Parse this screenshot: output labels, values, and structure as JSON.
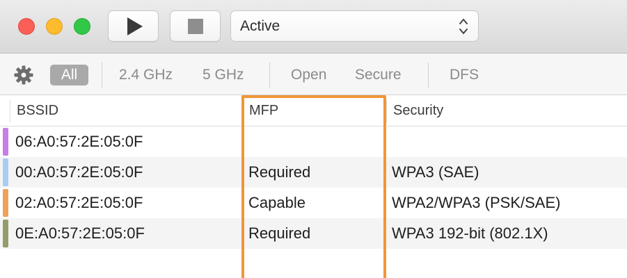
{
  "toolbar": {
    "mode_select": {
      "value": "Active"
    }
  },
  "filters": {
    "all": "All",
    "ghz24": "2.4 GHz",
    "ghz5": "5 GHz",
    "open": "Open",
    "secure": "Secure",
    "dfs": "DFS"
  },
  "table": {
    "columns": {
      "bssid": "BSSID",
      "mfp": "MFP",
      "security": "Security"
    },
    "rows": [
      {
        "bssid": "06:A0:57:2E:05:0F",
        "mfp": "",
        "security": "",
        "color": "#c77ee8"
      },
      {
        "bssid": "00:A0:57:2E:05:0F",
        "mfp": "Required",
        "security": "WPA3 (SAE)",
        "color": "#a9cdf5"
      },
      {
        "bssid": "02:A0:57:2E:05:0F",
        "mfp": "Capable",
        "security": "WPA2/WPA3 (PSK/SAE)",
        "color": "#eda25a"
      },
      {
        "bssid": "0E:A0:57:2E:05:0F",
        "mfp": "Required",
        "security": "WPA3 192-bit (802.1X)",
        "color": "#949d6a"
      }
    ]
  },
  "colors": {
    "highlight": "#f0963a",
    "filter_active_bg": "#a9a9a9"
  }
}
